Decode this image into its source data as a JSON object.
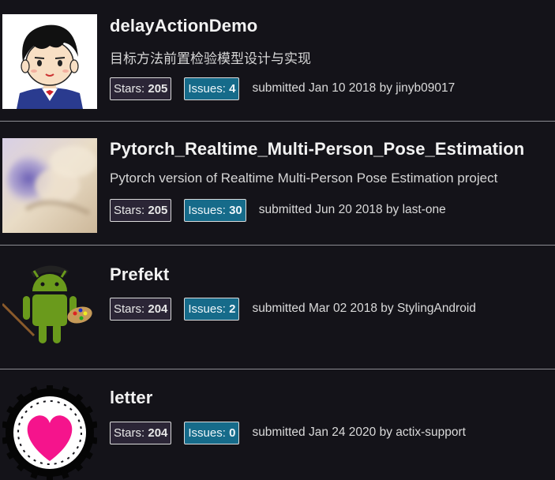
{
  "repos": [
    {
      "name": "delayActionDemo",
      "description": "目标方法前置检验模型设计与实现",
      "stars_label": "Stars:",
      "stars": "205",
      "issues_label": "Issues:",
      "issues": "4",
      "submitted": "submitted Jan 10 2018 by jinyb09017",
      "avatar_icon": "cartoon-boy-avatar"
    },
    {
      "name": "Pytorch_Realtime_Multi-Person_Pose_Estimation",
      "description": "Pytorch version of Realtime Multi-Person Pose Estimation project",
      "stars_label": "Stars:",
      "stars": "205",
      "issues_label": "Issues:",
      "issues": "30",
      "submitted": "submitted Jun 20 2018 by last-one",
      "avatar_icon": "blurred-photo-avatar"
    },
    {
      "name": "Prefekt",
      "description": "",
      "stars_label": "Stars:",
      "stars": "204",
      "issues_label": "Issues:",
      "issues": "2",
      "submitted": "submitted Mar 02 2018 by StylingAndroid",
      "avatar_icon": "android-painter-avatar"
    },
    {
      "name": "letter",
      "description": "",
      "stars_label": "Stars:",
      "stars": "204",
      "issues_label": "Issues:",
      "issues": "0",
      "submitted": "submitted Jan 24 2020 by actix-support",
      "avatar_icon": "pink-heart-gear-avatar"
    }
  ],
  "colors": {
    "background": "#141319",
    "stars_badge": "#2b2536",
    "issues_badge": "#166b8a",
    "divider": "#8c8c92"
  }
}
